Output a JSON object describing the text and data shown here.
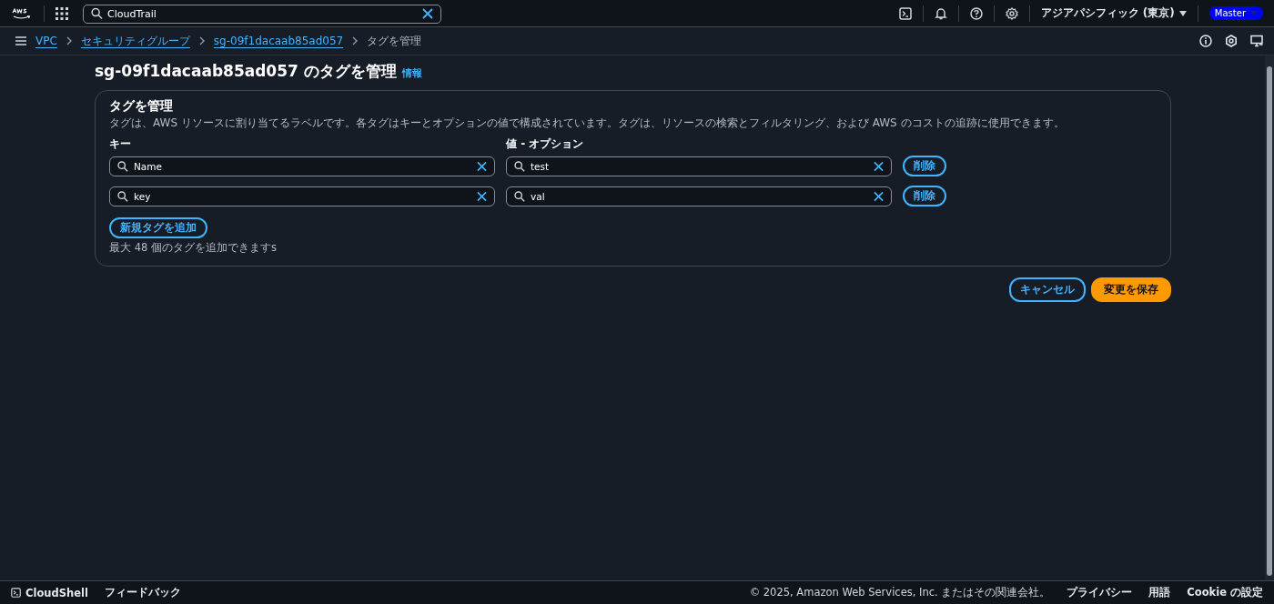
{
  "top_bar": {
    "search": {
      "value": "CloudTrail"
    },
    "region": "アジアパシフィック (東京)",
    "account": "Master"
  },
  "breadcrumbs": [
    {
      "label": "VPC",
      "link": true
    },
    {
      "label": "セキュリティグループ",
      "link": true
    },
    {
      "label": "sg-09f1dacaab85ad057",
      "link": true
    },
    {
      "label": "タグを管理",
      "link": false
    }
  ],
  "page": {
    "title": "sg-09f1dacaab85ad057 のタグを管理",
    "info": "情報"
  },
  "panel": {
    "title": "タグを管理",
    "description": "タグは、AWS リソースに割り当てるラベルです。各タグはキーとオプションの値で構成されています。タグは、リソースの検索とフィルタリング、および AWS のコストの追跡に使用できます。",
    "key_label": "キー",
    "value_label": "値 - オプション",
    "tags": [
      {
        "key": "Name",
        "value": "test",
        "remove": "削除"
      },
      {
        "key": "key",
        "value": "val",
        "remove": "削除"
      }
    ],
    "add_button": "新規タグを追加",
    "hint": "最大 48 個のタグを追加できますs"
  },
  "actions": {
    "cancel": "キャンセル",
    "save": "変更を保存"
  },
  "footer": {
    "cloudshell": "CloudShell",
    "feedback": "フィードバック",
    "copyright": "© 2025, Amazon Web Services, Inc. またはその関連会社。",
    "links": [
      "プライバシー",
      "用語",
      "Cookie の設定"
    ]
  }
}
